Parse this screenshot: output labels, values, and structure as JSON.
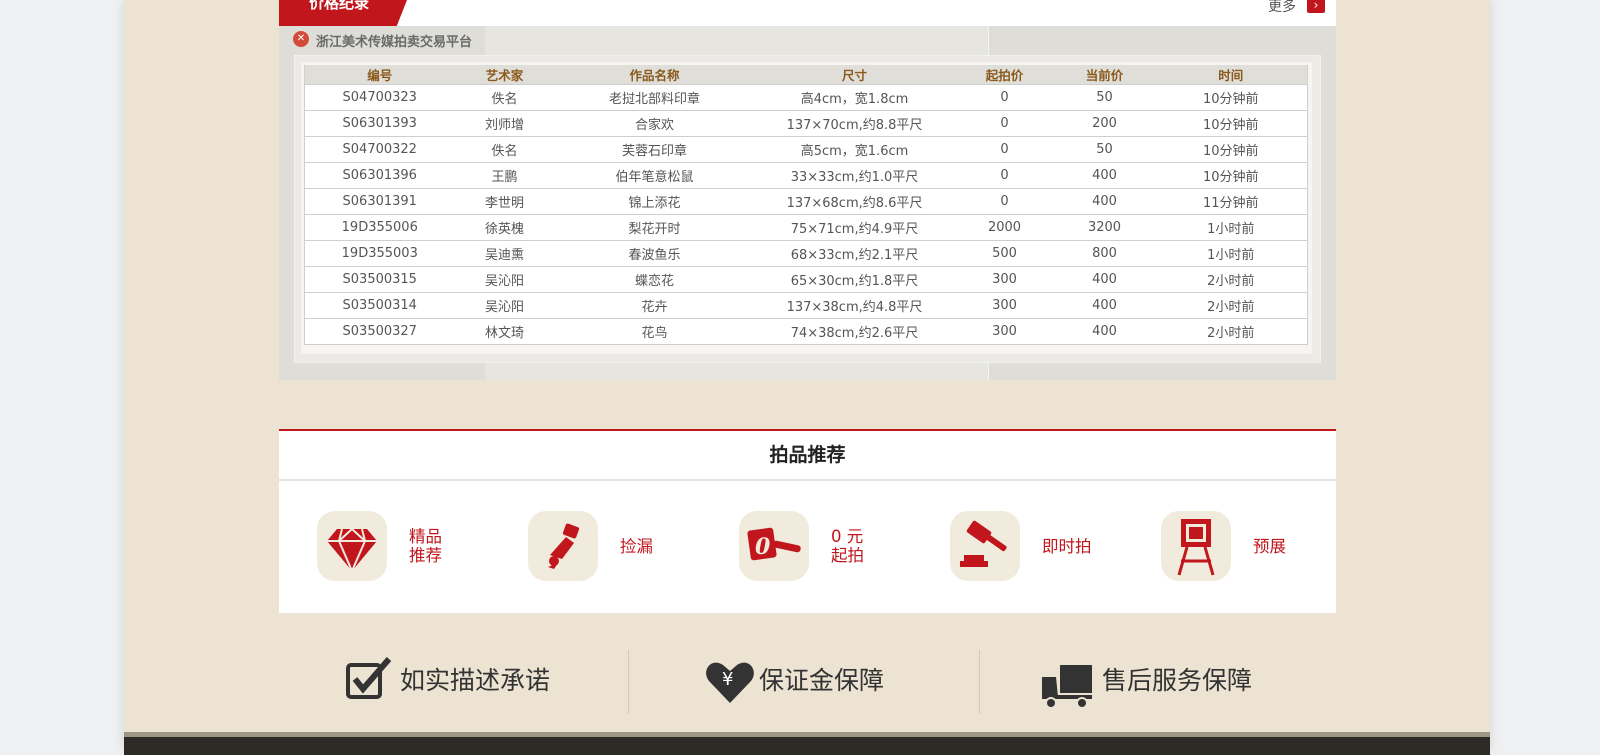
{
  "price_record": {
    "tab_label": "价格纪录",
    "more_label": "更多",
    "platform_name": "浙江美术传媒拍卖交易平台",
    "columns": [
      "编号",
      "艺术家",
      "作品名称",
      "尺寸",
      "起拍价",
      "当前价",
      "时间"
    ],
    "rows": [
      [
        "S04700323",
        "佚名",
        "老挝北部料印章",
        "高4cm，宽1.8cm",
        "0",
        "50",
        "10分钟前"
      ],
      [
        "S06301393",
        "刘师增",
        "合家欢",
        "137×70cm,约8.8平尺",
        "0",
        "200",
        "10分钟前"
      ],
      [
        "S04700322",
        "佚名",
        "芙蓉石印章",
        "高5cm，宽1.6cm",
        "0",
        "50",
        "10分钟前"
      ],
      [
        "S06301396",
        "王鹏",
        "伯年笔意松鼠",
        "33×33cm,约1.0平尺",
        "0",
        "400",
        "10分钟前"
      ],
      [
        "S06301391",
        "李世明",
        "锦上添花",
        "137×68cm,约8.6平尺",
        "0",
        "400",
        "11分钟前"
      ],
      [
        "19D355006",
        "徐英槐",
        "梨花开时",
        "75×71cm,约4.9平尺",
        "2000",
        "3200",
        "1小时前"
      ],
      [
        "19D355003",
        "吴迪熏",
        "春波鱼乐",
        "68×33cm,约2.1平尺",
        "500",
        "800",
        "1小时前"
      ],
      [
        "S03500315",
        "吴沁阳",
        "蝶恋花",
        "65×30cm,约1.8平尺",
        "300",
        "400",
        "2小时前"
      ],
      [
        "S03500314",
        "吴沁阳",
        "花卉",
        "137×38cm,约4.8平尺",
        "300",
        "400",
        "2小时前"
      ],
      [
        "S03500327",
        "林文琦",
        "花鸟",
        "74×38cm,约2.6平尺",
        "300",
        "400",
        "2小时前"
      ]
    ]
  },
  "recommend": {
    "title": "拍品推荐",
    "items": [
      {
        "label": "精品\n推荐",
        "icon": "diamond-icon"
      },
      {
        "label": "捡漏",
        "icon": "grab-hand-icon"
      },
      {
        "label": "0 元\n起拍",
        "icon": "zero-gavel-icon"
      },
      {
        "label": "即时拍",
        "icon": "gavel-icon"
      },
      {
        "label": "预展",
        "icon": "easel-icon"
      }
    ]
  },
  "guarantees": {
    "items": [
      {
        "label": "如实描述承诺",
        "icon": "checkbox-icon"
      },
      {
        "label": "保证金保障",
        "icon": "heart-yen-icon"
      },
      {
        "label": "售后服务保障",
        "icon": "truck-icon"
      }
    ]
  },
  "colors": {
    "accent_red": "#c1161c",
    "page_bg": "#ece3d2",
    "header_text": "#8a5a1c"
  }
}
